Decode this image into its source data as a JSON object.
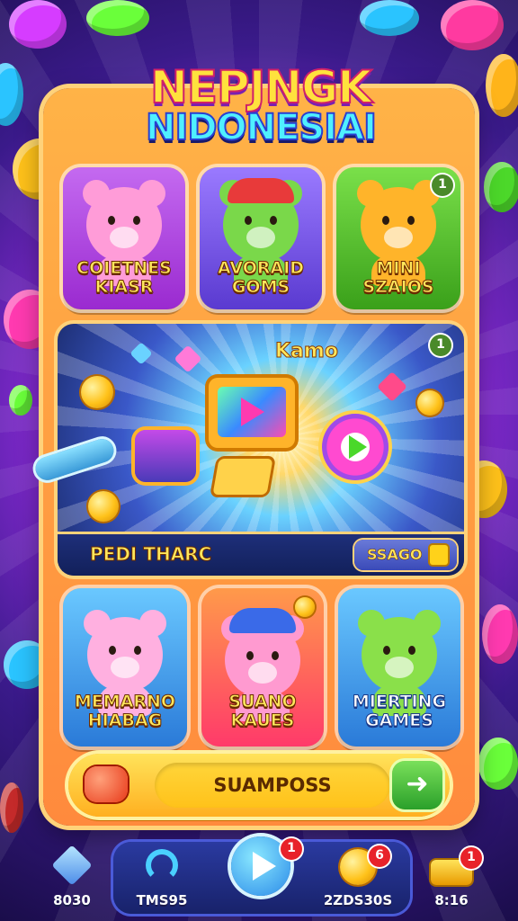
{
  "game": {
    "title_line1": "NEPJNGK",
    "title_line2": "NIDONESIAI"
  },
  "top_tiles": [
    {
      "label": "COIETNES\nKIASR",
      "color": "#b44ee0",
      "bear_color": "#ff9cd8"
    },
    {
      "label": "AVORAID\nGOMS",
      "color": "#7a5ae8",
      "bear_color": "#7ad84a"
    },
    {
      "label": "MINI\nSZAIOS",
      "color": "#4cc02a",
      "bear_color": "#ffb42a",
      "badge": "1"
    }
  ],
  "feature": {
    "title": "Kamo",
    "bar_label": "PEDI THARC",
    "bar_button": "SSAGO",
    "badge": "1"
  },
  "bottom_tiles": [
    {
      "label": "MEMARNO\nHIABAG",
      "color": "#3a9cf0",
      "bear_color": "#ffb0e0"
    },
    {
      "label": "SUANO\nKAUES",
      "color": "#ff4a6a",
      "bear_color": "#ff9ad0"
    },
    {
      "label": "MIERTING\nGAMES",
      "color": "#3a9cf0",
      "bear_color": "#8ae04a"
    }
  ],
  "search": {
    "value": "SUAMPOSS",
    "go_icon": "arrow-right-icon"
  },
  "nav": [
    {
      "label": "8030",
      "icon": "gem-icon"
    },
    {
      "label": "TMS95",
      "icon": "refresh-icon"
    },
    {
      "label": "",
      "icon": "play-icon",
      "badge": "1"
    },
    {
      "label": "2ZDS30S",
      "icon": "coin-icon",
      "badge": "6"
    },
    {
      "label": "8:16",
      "icon": "gold-bar-icon",
      "badge": "1"
    }
  ]
}
